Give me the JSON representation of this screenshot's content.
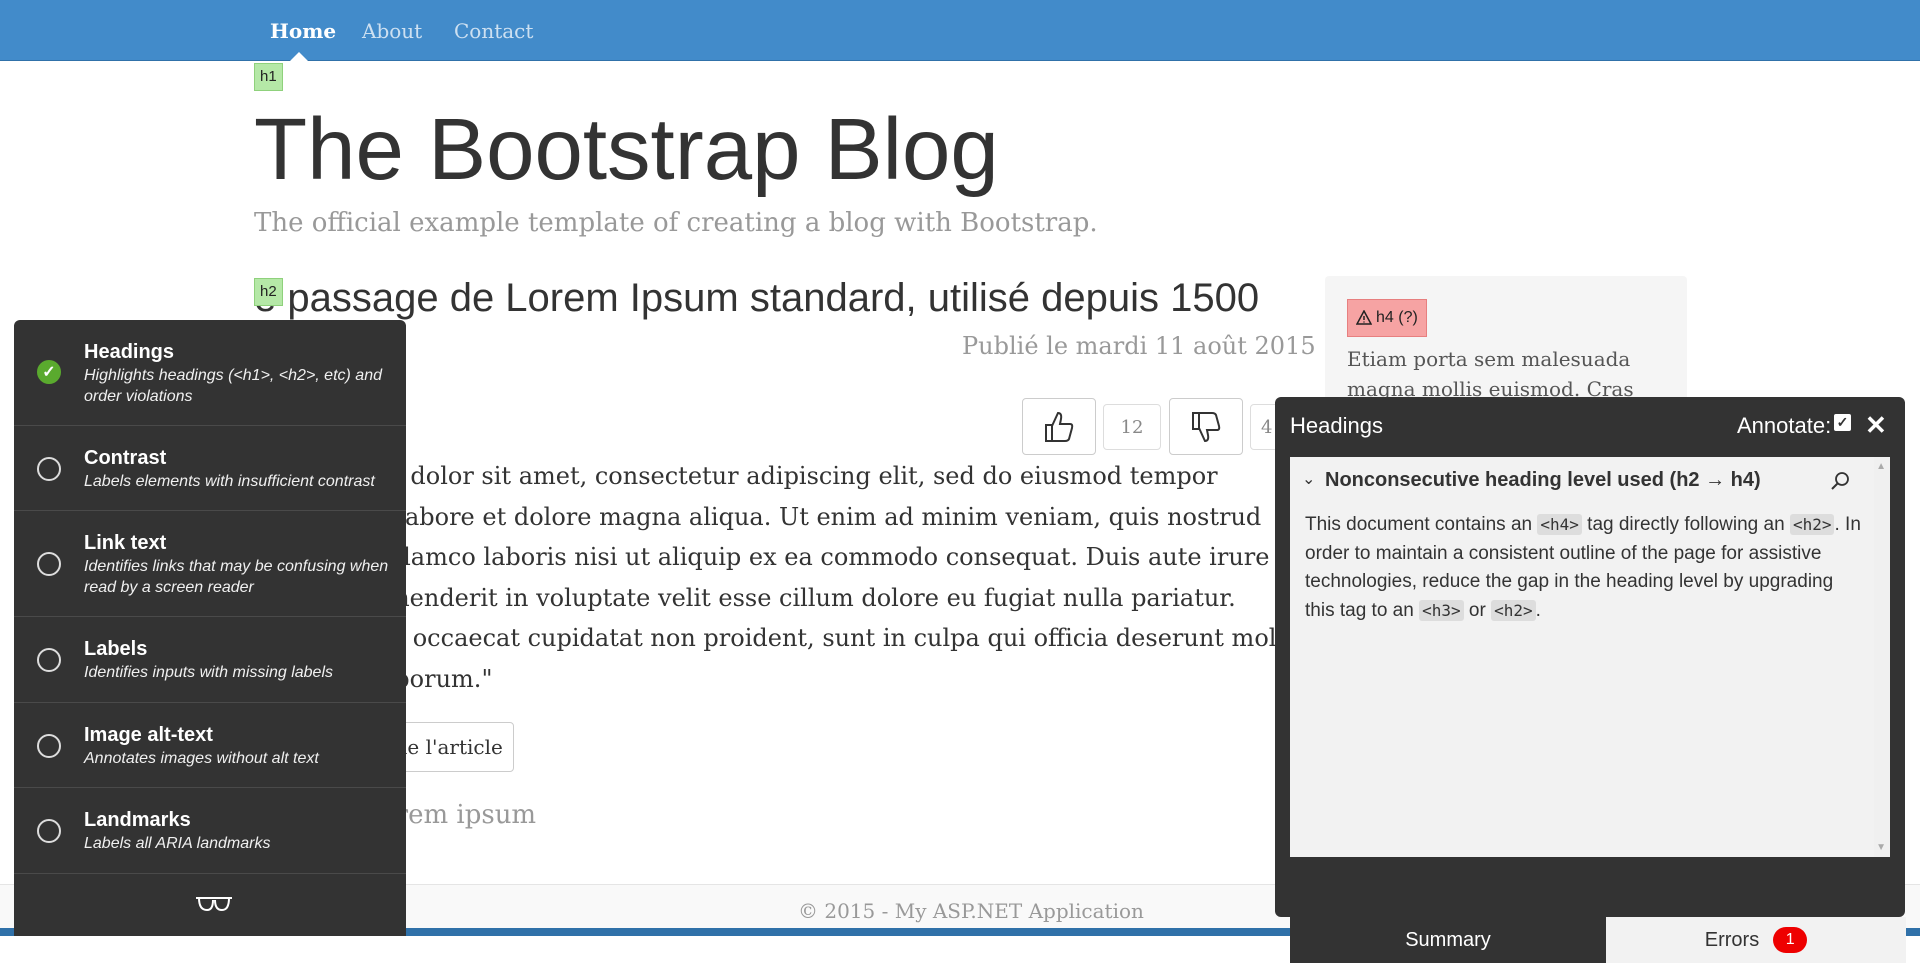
{
  "nav": {
    "items": [
      {
        "label": "Home",
        "active": true
      },
      {
        "label": "About",
        "active": false
      },
      {
        "label": "Contact",
        "active": false
      }
    ]
  },
  "page": {
    "h1_badge": "h1",
    "h2_badge": "h2",
    "title": "The Bootstrap Blog",
    "description": "The official example template of creating a blog with Bootstrap.",
    "post_title": "e passage de Lorem Ipsum standard, utilisé depuis 1500",
    "post_meta": "Publié le mardi 11 août 2015",
    "vote_count": "12",
    "vote_count_partial": "4",
    "body_lines": [
      "m dolor sit amet, consectetur adipiscing elit, sed do eiusmod tempor",
      "t labore et dolore magna aliqua. Ut enim ad minim veniam, quis nostrud",
      "ullamco laboris nisi ut aliquip ex ea commodo consequat. Duis aute irure",
      "ehenderit in voluptate velit esse cillum dolore eu fugiat nulla pariatur.",
      "nt occaecat cupidatat non proident, sunt in culpa qui officia deserunt moll",
      "aborum.\""
    ],
    "read_more": "le l'article",
    "section_link": "orem ipsum",
    "footer": "© 2015 - My ASP.NET Application"
  },
  "sidebar": {
    "badge": "h4 (?)",
    "text": "Etiam porta sem malesuada magna mollis euismod. Cras"
  },
  "tota": {
    "plugins": [
      {
        "title": "Headings",
        "desc": "Highlights headings (<h1>, <h2>, etc) and order violations",
        "checked": true
      },
      {
        "title": "Contrast",
        "desc": "Labels elements with insufficient contrast",
        "checked": false
      },
      {
        "title": "Link text",
        "desc": "Identifies links that may be confusing when read by a screen reader",
        "checked": false
      },
      {
        "title": "Labels",
        "desc": "Identifies inputs with missing labels",
        "checked": false
      },
      {
        "title": "Image alt-text",
        "desc": "Annotates images without alt text",
        "checked": false
      },
      {
        "title": "Landmarks",
        "desc": "Labels all ARIA landmarks",
        "checked": false
      }
    ]
  },
  "info": {
    "title": "Headings",
    "annotate_label": "Annotate:",
    "error_title": "Nonconsecutive heading level used (h2 → h4)",
    "desc_1": "This document contains an ",
    "code_1": "<h4>",
    "desc_2": " tag directly following an ",
    "code_2": "<h2>",
    "desc_3": ". In order to maintain a consistent outline of the page for assistive technologies, reduce the gap in the heading level by upgrading this tag to an ",
    "code_3": "<h3>",
    "desc_4": " or ",
    "code_4": "<h2>",
    "desc_5": ".",
    "tab_summary": "Summary",
    "tab_errors": "Errors",
    "error_count": "1"
  },
  "colors": {
    "navbar": "#428bca",
    "panel": "#333333",
    "checked": "#5aaa2e",
    "error_badge": "#e00000",
    "h_badge": "#b5e8a7",
    "h4_badge": "#f6a3a3"
  }
}
